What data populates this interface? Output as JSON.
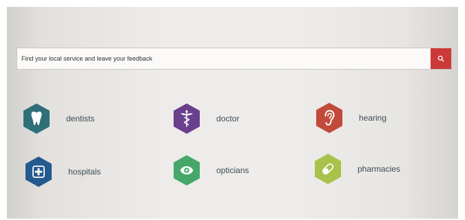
{
  "search": {
    "placeholder": "Find your local service and leave your feedback",
    "button_icon": "search-icon",
    "button_color": "#cc3a38"
  },
  "services": [
    {
      "label": "dentists",
      "icon": "tooth-icon",
      "color": "#2f6f78"
    },
    {
      "label": "doctor",
      "icon": "caduceus-icon",
      "color": "#6a3f8c"
    },
    {
      "label": "hearing",
      "icon": "ear-icon",
      "color": "#c24a3a"
    },
    {
      "label": "hospitals",
      "icon": "hospital-cross-icon",
      "color": "#245a8e"
    },
    {
      "label": "opticians",
      "icon": "eye-icon",
      "color": "#45a86a"
    },
    {
      "label": "pharmacies",
      "icon": "pill-icon",
      "color": "#a8c24a"
    }
  ]
}
